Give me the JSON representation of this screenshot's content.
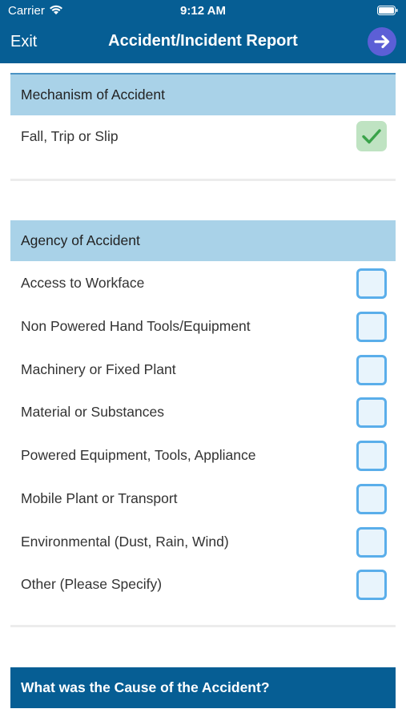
{
  "status_bar": {
    "carrier": "Carrier",
    "time": "9:12 AM"
  },
  "nav": {
    "exit_label": "Exit",
    "title": "Accident/Incident Report",
    "next_icon": "arrow-right-icon"
  },
  "mechanism": {
    "header": "Mechanism of Accident",
    "item_label": "Fall, Trip or Slip",
    "item_checked": true
  },
  "agency": {
    "header": "Agency of Accident",
    "items": [
      {
        "label": "Access to Workface",
        "checked": false
      },
      {
        "label": "Non Powered Hand Tools/Equipment",
        "checked": false
      },
      {
        "label": "Machinery or Fixed Plant",
        "checked": false
      },
      {
        "label": "Material or Substances",
        "checked": false
      },
      {
        "label": "Powered Equipment, Tools, Appliance",
        "checked": false
      },
      {
        "label": "Mobile Plant or Transport",
        "checked": false
      },
      {
        "label": "Environmental (Dust, Rain, Wind)",
        "checked": false
      },
      {
        "label": "Other (Please Specify)",
        "checked": false
      }
    ]
  },
  "cause": {
    "header": "What was the Cause of the Accident?"
  },
  "colors": {
    "header_bg": "#065e94",
    "section_bg": "#a9d2e8",
    "checkbox_border": "#5aaeea",
    "checked_bg": "#bfe3c2",
    "check_mark": "#3aa34a",
    "next_button": "#5c5fd6"
  }
}
